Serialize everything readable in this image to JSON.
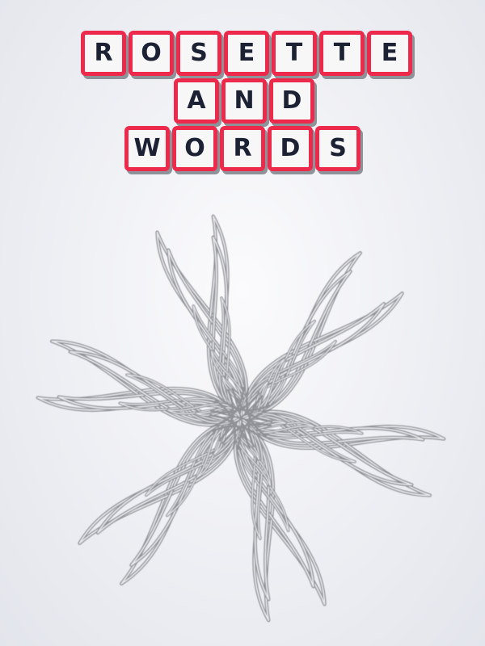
{
  "title": {
    "rows": [
      [
        "R",
        "O",
        "S",
        "E",
        "T",
        "T",
        "E"
      ],
      [
        "A",
        "N",
        "D"
      ],
      [
        "W",
        "O",
        "R",
        "D",
        "S"
      ]
    ]
  },
  "colors": {
    "tile_border": "#ee2a4c",
    "tile_fill": "#f7f7f8",
    "letter": "#1c2134",
    "rosette_stroke": "#8f9196"
  },
  "rosette": {
    "arms": 6
  }
}
